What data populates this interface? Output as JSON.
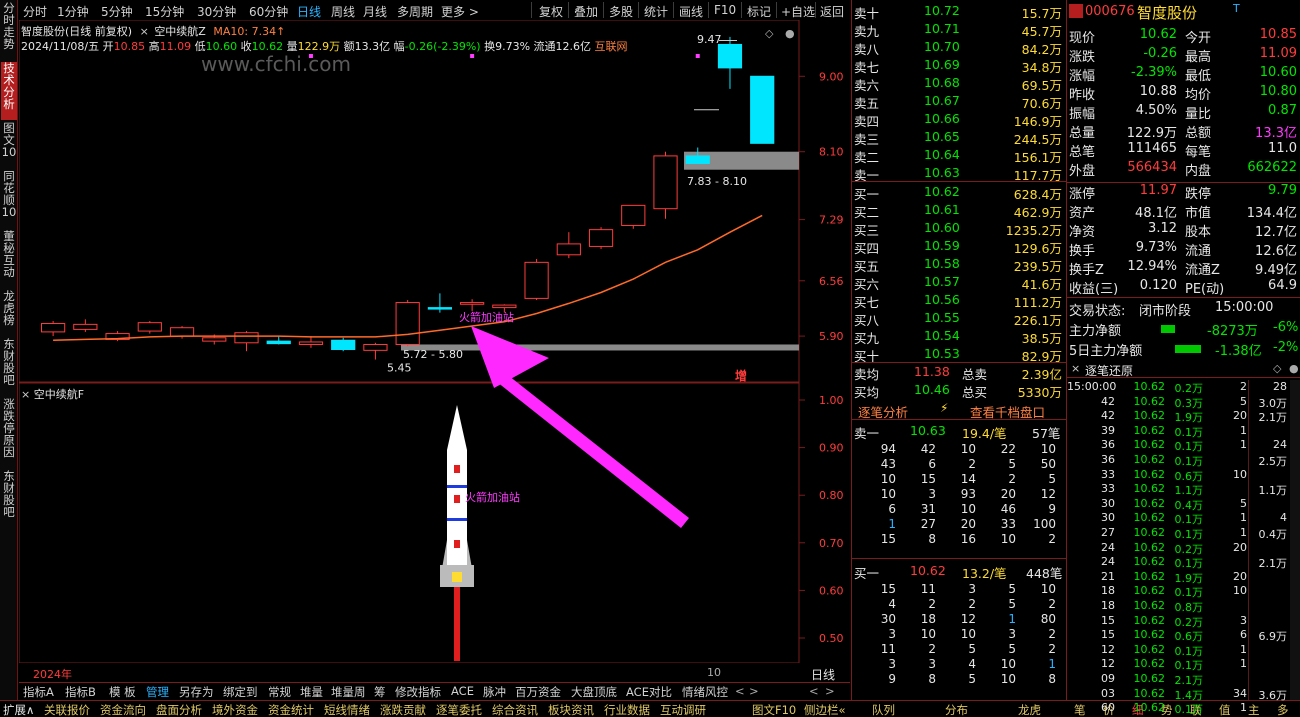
{
  "vertical_tabs": [
    {
      "label": "分时走势",
      "active": false
    },
    {
      "label": "技术分析",
      "active": true
    },
    {
      "label": "图文10",
      "active": false
    },
    {
      "label": "同花顺10",
      "active": false
    },
    {
      "label": "董秘互动",
      "active": false
    },
    {
      "label": "龙虎榜",
      "active": false
    },
    {
      "label": "东财股吧",
      "active": false
    },
    {
      "label": "涨跌停原因",
      "active": false
    },
    {
      "label": "东财股吧",
      "active": false
    }
  ],
  "period_tabs": [
    "分时",
    "1分钟",
    "5分钟",
    "15分钟",
    "30分钟",
    "60分钟",
    "日线",
    "周线",
    "月线",
    "多周期",
    "更多 >"
  ],
  "active_period": "日线",
  "toolbar": [
    "复权",
    "叠加",
    "多股",
    "统计",
    "画线",
    "F10",
    "标记",
    "+自选",
    "返回"
  ],
  "chart_header": {
    "name": "智度股份(日线 前复权)",
    "indicator": "空中续航Z",
    "ma": "MA10: 7.34↑",
    "date": "2024/11/08/五",
    "open_label": "开",
    "open": "10.85",
    "high_label": "高",
    "high": "11.09",
    "low_label": "低",
    "low": "10.60",
    "close_label": "收",
    "close": "10.62",
    "vol_label": "量",
    "vol": "122.9万",
    "amt_label": "额",
    "amt": "13.3亿",
    "chg_label": "幅",
    "chg": "-0.26(-2.39%)",
    "turn_label": "换",
    "turn": "9.73%",
    "float_label": "流通",
    "float": "12.6亿",
    "sector": "互联网"
  },
  "watermark": "www.cfchi.com",
  "price_axis": [
    "9.00",
    "8.10",
    "7.29",
    "6.56",
    "5.90"
  ],
  "annotations": {
    "high_label": "9.47",
    "zone_upper": "7.83 - 8.10",
    "zone_lower": "5.72 - 5.80",
    "low_label": "5.45",
    "rocket_text": "火箭加油站",
    "zeng": "增"
  },
  "sub_indicator": {
    "name": "空中续航F",
    "axis": [
      "1.00",
      "0.90",
      "0.80",
      "0.70",
      "0.60",
      "0.50"
    ],
    "rocket_text": "火箭加油站"
  },
  "time_axis": {
    "year": "2024年",
    "month": "10",
    "period": "日线"
  },
  "chart_data": {
    "type": "candlestick",
    "candles": [
      {
        "o": 5.95,
        "h": 6.08,
        "l": 5.9,
        "c": 6.05
      },
      {
        "o": 5.98,
        "h": 6.1,
        "l": 5.95,
        "c": 6.04
      },
      {
        "o": 5.86,
        "h": 5.96,
        "l": 5.84,
        "c": 5.93
      },
      {
        "o": 5.96,
        "h": 6.08,
        "l": 5.93,
        "c": 6.06
      },
      {
        "o": 5.9,
        "h": 6.02,
        "l": 5.87,
        "c": 6.0
      },
      {
        "o": 5.84,
        "h": 5.92,
        "l": 5.8,
        "c": 5.88
      },
      {
        "o": 5.82,
        "h": 5.96,
        "l": 5.72,
        "c": 5.94
      },
      {
        "o": 5.84,
        "h": 5.9,
        "l": 5.8,
        "c": 5.81
      },
      {
        "o": 5.8,
        "h": 5.9,
        "l": 5.76,
        "c": 5.83
      },
      {
        "o": 5.85,
        "h": 5.88,
        "l": 5.72,
        "c": 5.74
      },
      {
        "o": 5.73,
        "h": 5.82,
        "l": 5.62,
        "c": 5.8
      },
      {
        "o": 5.8,
        "h": 6.33,
        "l": 5.78,
        "c": 6.3
      },
      {
        "o": 6.24,
        "h": 6.41,
        "l": 6.18,
        "c": 6.23
      },
      {
        "o": 6.28,
        "h": 6.34,
        "l": 6.2,
        "c": 6.3
      },
      {
        "o": 6.24,
        "h": 6.28,
        "l": 6.18,
        "c": 6.27
      },
      {
        "o": 6.35,
        "h": 6.82,
        "l": 6.33,
        "c": 6.78
      },
      {
        "o": 6.87,
        "h": 7.14,
        "l": 6.83,
        "c": 7.0
      },
      {
        "o": 6.97,
        "h": 7.2,
        "l": 6.94,
        "c": 7.17
      },
      {
        "o": 7.22,
        "h": 7.45,
        "l": 7.18,
        "c": 7.46
      },
      {
        "o": 7.42,
        "h": 8.1,
        "l": 7.3,
        "c": 8.05
      },
      {
        "o": 8.05,
        "h": 8.15,
        "l": 7.96,
        "c": 7.96
      },
      {
        "o": 9.38,
        "h": 9.47,
        "l": 8.85,
        "c": 9.1
      },
      {
        "o": 9.0,
        "h": 9.0,
        "l": 8.2,
        "c": 8.2
      }
    ],
    "ma10": [
      5.85,
      5.86,
      5.87,
      5.89,
      5.9,
      5.9,
      5.9,
      5.9,
      5.89,
      5.89,
      5.89,
      5.92,
      5.97,
      6.02,
      6.07,
      6.17,
      6.29,
      6.42,
      6.58,
      6.78,
      6.93,
      7.14,
      7.34
    ],
    "ylim": [
      5.4,
      9.6
    ]
  },
  "order_book": {
    "sells": [
      {
        "label": "卖十",
        "price": "10.72",
        "vol": "15.7万"
      },
      {
        "label": "卖九",
        "price": "10.71",
        "vol": "45.7万"
      },
      {
        "label": "卖八",
        "price": "10.70",
        "vol": "84.2万"
      },
      {
        "label": "卖七",
        "price": "10.69",
        "vol": "34.8万"
      },
      {
        "label": "卖六",
        "price": "10.68",
        "vol": "69.5万"
      },
      {
        "label": "卖五",
        "price": "10.67",
        "vol": "70.6万"
      },
      {
        "label": "卖四",
        "price": "10.66",
        "vol": "146.9万"
      },
      {
        "label": "卖三",
        "price": "10.65",
        "vol": "244.5万"
      },
      {
        "label": "卖二",
        "price": "10.64",
        "vol": "156.1万"
      },
      {
        "label": "卖一",
        "price": "10.63",
        "vol": "117.7万"
      }
    ],
    "buys": [
      {
        "label": "买一",
        "price": "10.62",
        "vol": "628.4万"
      },
      {
        "label": "买二",
        "price": "10.61",
        "vol": "462.9万"
      },
      {
        "label": "买三",
        "price": "10.60",
        "vol": "1235.2万"
      },
      {
        "label": "买四",
        "price": "10.59",
        "vol": "129.6万"
      },
      {
        "label": "买五",
        "price": "10.58",
        "vol": "239.5万"
      },
      {
        "label": "买六",
        "price": "10.57",
        "vol": "41.6万"
      },
      {
        "label": "买七",
        "price": "10.56",
        "vol": "111.2万"
      },
      {
        "label": "买八",
        "price": "10.55",
        "vol": "226.1万"
      },
      {
        "label": "买九",
        "price": "10.54",
        "vol": "38.5万"
      },
      {
        "label": "买十",
        "price": "10.53",
        "vol": "82.9万"
      }
    ],
    "sell_avg_label": "卖均",
    "sell_avg": "11.38",
    "total_sell_label": "总卖",
    "total_sell": "2.39亿",
    "buy_avg_label": "买均",
    "buy_avg": "10.46",
    "total_buy_label": "总买",
    "total_buy": "5330万"
  },
  "quote": {
    "code": "000676",
    "name": "智度股份",
    "rows": [
      {
        "l1": "现价",
        "v1": "10.62",
        "c1": "grn",
        "l2": "今开",
        "v2": "10.85",
        "c2": "red"
      },
      {
        "l1": "涨跌",
        "v1": "-0.26",
        "c1": "grn",
        "l2": "最高",
        "v2": "11.09",
        "c2": "red"
      },
      {
        "l1": "涨幅",
        "v1": "-2.39%",
        "c1": "grn",
        "l2": "最低",
        "v2": "10.60",
        "c2": "grn"
      },
      {
        "l1": "昨收",
        "v1": "10.88",
        "c1": "wht",
        "l2": "均价",
        "v2": "10.80",
        "c2": "grn"
      },
      {
        "l1": "振幅",
        "v1": "4.50%",
        "c1": "wht",
        "l2": "量比",
        "v2": "0.87",
        "c2": "grn"
      },
      {
        "l1": "总量",
        "v1": "122.9万",
        "c1": "wht",
        "l2": "总额",
        "v2": "13.3亿",
        "c2": "mag"
      },
      {
        "l1": "总笔",
        "v1": "111465",
        "c1": "wht",
        "l2": "每笔",
        "v2": "11.0",
        "c2": "wht"
      },
      {
        "l1": "外盘",
        "v1": "566434",
        "c1": "red",
        "l2": "内盘",
        "v2": "662622",
        "c2": "grn"
      }
    ],
    "rows2": [
      {
        "l1": "涨停",
        "v1": "11.97",
        "c1": "red",
        "l2": "跌停",
        "v2": "9.79",
        "c2": "grn"
      },
      {
        "l1": "资产",
        "v1": "48.1亿",
        "c1": "wht",
        "l2": "市值",
        "v2": "134.4亿",
        "c2": "wht"
      },
      {
        "l1": "净资",
        "v1": "3.12",
        "c1": "wht",
        "l2": "股本",
        "v2": "12.7亿",
        "c2": "wht"
      },
      {
        "l1": "换手",
        "v1": "9.73%",
        "c1": "wht",
        "l2": "流通",
        "v2": "12.6亿",
        "c2": "wht"
      },
      {
        "l1": "换手Z",
        "v1": "12.94%",
        "c1": "wht",
        "l2": "流通Z",
        "v2": "9.49亿",
        "c2": "wht"
      },
      {
        "l1": "收益(三)",
        "v1": "0.120",
        "c1": "wht",
        "l2": "PE(动)",
        "v2": "64.9",
        "c2": "wht"
      }
    ],
    "trade_status_label": "交易状态:",
    "trade_status": "闭市阶段",
    "trade_time": "15:00:00",
    "main_net_label": "主力净额",
    "main_net": "-8273万",
    "main_net_pct": "-6%",
    "main_net5_label": "5日主力净额",
    "main_net5": "-1.38亿",
    "main_net5_pct": "-2%"
  },
  "tick_detail": {
    "tab1": "逐笔分析",
    "tab2": "查看千档盘口",
    "sell1": {
      "label": "卖一",
      "price": "10.63",
      "per": "19.4/笔",
      "count": "57笔"
    },
    "sell_grid": [
      [
        94,
        42,
        10,
        22,
        10
      ],
      [
        43,
        6,
        2,
        5,
        50
      ],
      [
        10,
        15,
        14,
        2,
        5
      ],
      [
        10,
        3,
        93,
        20,
        12
      ],
      [
        6,
        31,
        10,
        46,
        9
      ],
      [
        1,
        27,
        20,
        33,
        100
      ],
      [
        15,
        8,
        16,
        10,
        2
      ]
    ],
    "buy1": {
      "label": "买一",
      "price": "10.62",
      "per": "13.2/笔",
      "count": "448笔"
    },
    "buy_grid": [
      [
        15,
        11,
        3,
        5,
        10
      ],
      [
        4,
        2,
        2,
        5,
        2
      ],
      [
        30,
        18,
        12,
        1,
        80
      ],
      [
        3,
        10,
        10,
        3,
        2
      ],
      [
        11,
        2,
        5,
        5,
        2
      ],
      [
        3,
        3,
        4,
        10,
        1
      ],
      [
        9,
        8,
        5,
        10,
        8
      ]
    ]
  },
  "tick_list": {
    "title": "逐笔还原",
    "rows": [
      {
        "t": "15:00:00",
        "p": "10.62",
        "v": "0.2万",
        "n": "2",
        "v2": "28"
      },
      {
        "t": "42",
        "p": "10.62",
        "v": "0.3万",
        "n": "5",
        "v2": "3.0万"
      },
      {
        "t": "42",
        "p": "10.62",
        "v": "1.9万",
        "n": "20",
        "v2": "2.1万"
      },
      {
        "t": "39",
        "p": "10.62",
        "v": "0.1万",
        "n": "1",
        "v2": ""
      },
      {
        "t": "36",
        "p": "10.62",
        "v": "0.1万",
        "n": "1",
        "v2": "24"
      },
      {
        "t": "36",
        "p": "10.62",
        "v": "0.1万",
        "n": "",
        "v2": "2.5万"
      },
      {
        "t": "33",
        "p": "10.62",
        "v": "0.6万",
        "n": "10",
        "v2": ""
      },
      {
        "t": "33",
        "p": "10.62",
        "v": "1.1万",
        "n": "",
        "v2": "1.1万"
      },
      {
        "t": "30",
        "p": "10.62",
        "v": "0.4万",
        "n": "5",
        "v2": ""
      },
      {
        "t": "30",
        "p": "10.62",
        "v": "0.1万",
        "n": "1",
        "v2": "4"
      },
      {
        "t": "27",
        "p": "10.62",
        "v": "0.1万",
        "n": "1",
        "v2": "0.4万"
      },
      {
        "t": "24",
        "p": "10.62",
        "v": "0.2万",
        "n": "20",
        "v2": ""
      },
      {
        "t": "24",
        "p": "10.62",
        "v": "0.1万",
        "n": "",
        "v2": "2.1万"
      },
      {
        "t": "21",
        "p": "10.62",
        "v": "1.9万",
        "n": "20",
        "v2": ""
      },
      {
        "t": "18",
        "p": "10.62",
        "v": "0.1万",
        "n": "10",
        "v2": ""
      },
      {
        "t": "18",
        "p": "10.62",
        "v": "0.8万",
        "n": "",
        "v2": ""
      },
      {
        "t": "15",
        "p": "10.62",
        "v": "0.2万",
        "n": "3",
        "v2": ""
      },
      {
        "t": "15",
        "p": "10.62",
        "v": "0.6万",
        "n": "6",
        "v2": "6.9万"
      },
      {
        "t": "12",
        "p": "10.62",
        "v": "0.1万",
        "n": "1",
        "v2": ""
      },
      {
        "t": "12",
        "p": "10.62",
        "v": "0.1万",
        "n": "1",
        "v2": ""
      },
      {
        "t": "09",
        "p": "10.62",
        "v": "2.1万",
        "n": "",
        "v2": ""
      },
      {
        "t": "03",
        "p": "10.62",
        "v": "1.4万",
        "n": "34",
        "v2": "3.6万"
      },
      {
        "t": "60",
        "p": "10.62",
        "v": "0.1万",
        "n": "1",
        "v2": ""
      }
    ]
  },
  "bottom_tabs": [
    "指标A",
    "指标B",
    "模 板",
    "管理",
    "另存为",
    "绑定到",
    "常规",
    "堆量",
    "堆量周",
    "筹",
    "修改指标",
    "ACE",
    "脉冲",
    "百万资金",
    "大盘顶底",
    "ACE对比",
    "情绪风控"
  ],
  "active_bottom_tab": "管理",
  "status_tabs": [
    "扩展∧",
    "关联报价",
    "资金流向",
    "盘面分析",
    "境外资金",
    "资金统计",
    "短线情绪",
    "涨跌贡献",
    "逐笔委托",
    "综合资讯",
    "板块资讯",
    "行业数据",
    "互动调研",
    "图文F10",
    "侧边栏«"
  ],
  "right_status_tabs": [
    "队列",
    "分布",
    "龙虎",
    "笔",
    "价",
    "细",
    "势",
    "联",
    "值",
    "主",
    "多"
  ],
  "active_right_status": "细"
}
